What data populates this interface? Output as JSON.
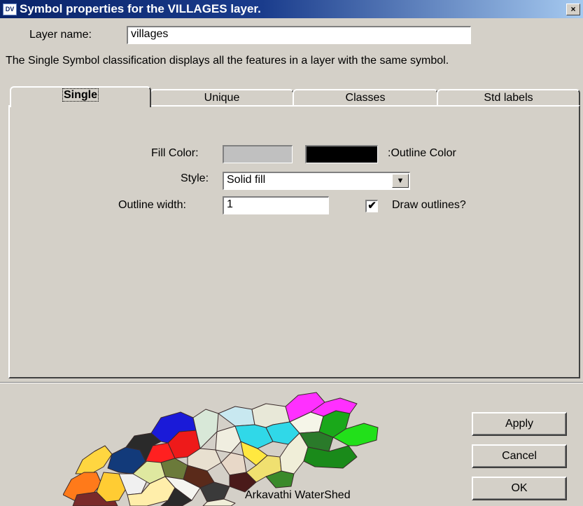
{
  "window": {
    "app_icon": "DV",
    "title": "Symbol properties for the VILLAGES layer.",
    "close_glyph": "×"
  },
  "layer_name": {
    "label": "Layer name:",
    "value": "villages"
  },
  "description": "The Single Symbol classification displays all the features in a layer with the same symbol.",
  "tabs": [
    {
      "label": "Single",
      "active": true
    },
    {
      "label": "Unique",
      "active": false
    },
    {
      "label": "Classes",
      "active": false
    },
    {
      "label": "Std labels",
      "active": false
    }
  ],
  "single": {
    "fill_color_label": "Fill Color:",
    "fill_color": "#c0c0c0",
    "outline_color_label": ":Outline Color",
    "outline_color": "#000000",
    "style_label": "Style:",
    "style_value": "Solid fill",
    "dropdown_glyph": "▼",
    "outline_width_label": "Outline width:",
    "outline_width_value": "1",
    "draw_outlines_label": "Draw outlines?",
    "draw_outlines_checked": true,
    "check_glyph": "✔"
  },
  "preview": {
    "caption": "Arkavathi WaterShed"
  },
  "buttons": {
    "apply": "Apply",
    "cancel": "Cancel",
    "ok": "OK"
  }
}
